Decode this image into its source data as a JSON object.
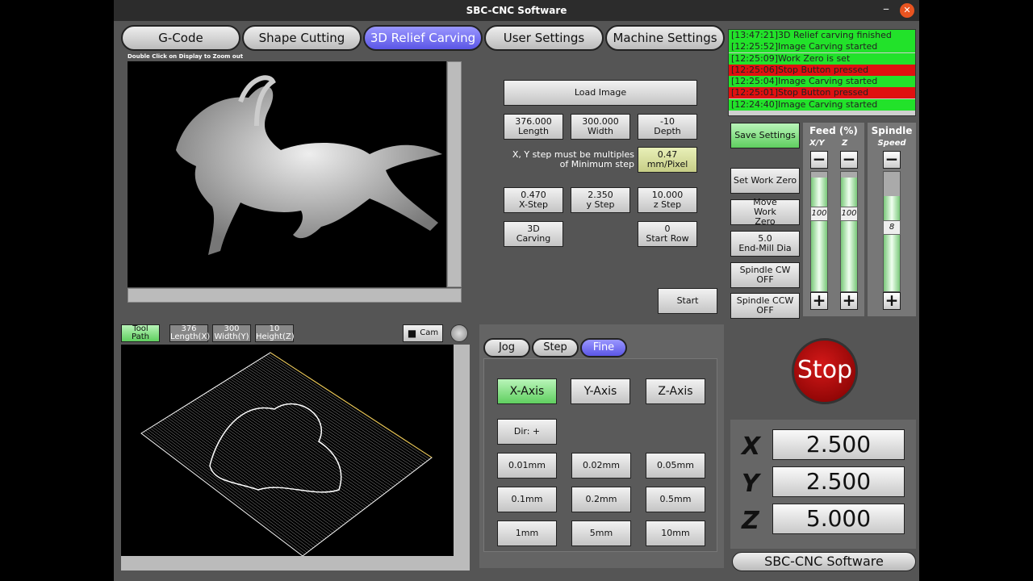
{
  "window": {
    "title": "SBC-CNC Software",
    "minimize": "–",
    "close": "✕"
  },
  "tabs": [
    "G-Code",
    "Shape Cutting",
    "3D Relief Carving",
    "User Settings",
    "Machine Settings"
  ],
  "image_hint": "Double Click on Display to Zoom out",
  "image_panel": {
    "load": "Load Image",
    "length": {
      "value": "376.000",
      "label": "Length"
    },
    "width": {
      "value": "300.000",
      "label": "Width"
    },
    "depth": {
      "value": "-10",
      "label": "Depth"
    },
    "step_note": "X, Y step must be multiples of Minimum step",
    "min_step": {
      "value": "0.47",
      "label": "mm/Pixel"
    },
    "xstep": {
      "value": "0.470",
      "label": "X-Step"
    },
    "ystep": {
      "value": "2.350",
      "label": "y Step"
    },
    "zstep": {
      "value": "10.000",
      "label": "z Step"
    },
    "carving": {
      "value": "3D",
      "label": "Carving"
    },
    "startrow": {
      "value": "0",
      "label": "Start Row"
    },
    "start": "Start"
  },
  "log": [
    {
      "time": "[13:47:21]",
      "text": "3D Relief carving finished",
      "status": "ok"
    },
    {
      "time": "[12:25:52]",
      "text": "Image Carving started",
      "status": "ok"
    },
    {
      "time": "[12:25:09]",
      "text": "Work Zero is set",
      "status": "ok"
    },
    {
      "time": "[12:25:06]",
      "text": "Stop Button pressed",
      "status": "err"
    },
    {
      "time": "[12:25:04]",
      "text": "Image Carving started",
      "status": "ok"
    },
    {
      "time": "[12:25:01]",
      "text": "Stop Button pressed",
      "status": "err"
    },
    {
      "time": "[12:24:40]",
      "text": "Image Carving started",
      "status": "ok"
    }
  ],
  "side": {
    "save": "Save Settings",
    "set_zero": "Set Work Zero",
    "move_zero": "Move Work Zero",
    "endmill": {
      "value": "5.0",
      "label": "End-Mill Dia"
    },
    "cw": "Spindle CW OFF",
    "ccw": "Spindle CCW OFF"
  },
  "feed": {
    "title": "Feed (%)",
    "xy_label": "X/Y",
    "z_label": "Z",
    "xy": "100",
    "z": "100",
    "xy_level": 0.95,
    "z_level": 0.95
  },
  "spindle": {
    "title": "Spindle",
    "sub": "Speed",
    "value": "8",
    "level": 0.8
  },
  "toolpath": {
    "tool": {
      "value": "Tool",
      "label": "Path"
    },
    "length": {
      "value": "376",
      "label": "Length(X)"
    },
    "width": {
      "value": "300",
      "label": "Width(Y)"
    },
    "height": {
      "value": "10",
      "label": "Height(Z)"
    },
    "cam": "Cam"
  },
  "jog": {
    "modes": [
      "Jog",
      "Step",
      "Fine"
    ],
    "axes": [
      "X-Axis",
      "Y-Axis",
      "Z-Axis"
    ],
    "dir": "Dir: +",
    "steps": [
      "0.01mm",
      "0.02mm",
      "0.05mm",
      "0.1mm",
      "0.2mm",
      "0.5mm",
      "1mm",
      "5mm",
      "10mm"
    ]
  },
  "stop": "Stop",
  "dro": {
    "x_label": "X",
    "y_label": "Y",
    "z_label": "Z",
    "x": "2.500",
    "y": "2.500",
    "z": "5.000"
  },
  "brand": "SBC-CNC Software",
  "colors": {
    "active_tab": "#5b56e6",
    "log_ok": "#22e22a",
    "log_err": "#e01010",
    "stop": "#c00000"
  }
}
